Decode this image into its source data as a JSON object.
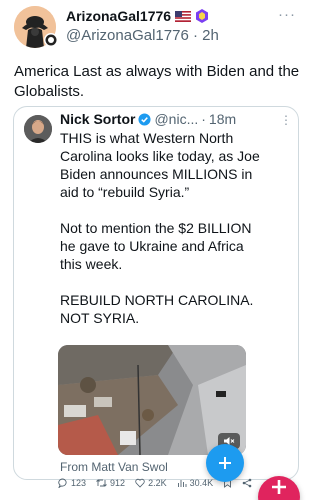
{
  "post": {
    "display_name": "ArizonaGal1776",
    "handle": "@ArizonaGal1776",
    "separator": "·",
    "time": "2h",
    "more_icon": "more-horizontal-icon",
    "text": "America Last as always with Biden and the Globalists."
  },
  "quote": {
    "display_name": "Nick Sortor",
    "handle": "@nic...",
    "separator": "·",
    "time": "18m",
    "paragraphs": [
      "THIS is what Western North Carolina looks like today, as Joe Biden announces MILLIONS in aid to “rebuild Syria.”",
      "Not to mention the $2 BILLION he gave to Ukraine and Africa this week.",
      "REBUILD NORTH CAROLINA. NOT SYRIA."
    ],
    "source": "From Matt Van Swol"
  },
  "actions": {
    "replies": "123",
    "reposts": "912",
    "likes": "2.2K",
    "views": "30.4K"
  },
  "colors": {
    "accent": "#1d9bf0",
    "fab_secondary": "#e0245e",
    "verified": "#1d9bf0",
    "badge_purple": "#7b3ff2"
  }
}
